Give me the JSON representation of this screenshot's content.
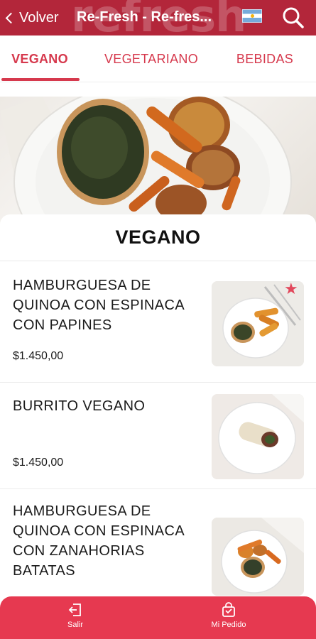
{
  "header": {
    "back_label": "Volver",
    "title": "Re-Fresh - Re-fres...",
    "watermark": "refresh"
  },
  "tabs": [
    {
      "label": "VEGANO",
      "active": true
    },
    {
      "label": "VEGETARIANO",
      "active": false
    },
    {
      "label": "BEBIDAS",
      "active": false
    }
  ],
  "category": {
    "title": "VEGANO"
  },
  "items": [
    {
      "name": "HAMBURGUESA DE QUINOA CON ESPINACA CON PAPINES",
      "price": "$1.450,00",
      "favorite": true
    },
    {
      "name": "BURRITO VEGANO",
      "price": "$1.450,00",
      "favorite": false
    },
    {
      "name": "HAMBURGUESA DE QUINOA CON ESPINACA CON ZANAHORIAS BATATAS",
      "price": "",
      "favorite": false
    }
  ],
  "bottom_nav": {
    "exit_label": "Salir",
    "order_label": "Mi Pedido"
  },
  "colors": {
    "header_bg": "#b3263a",
    "accent": "#d6394d",
    "bottom_bar": "#e63950"
  },
  "icons": {
    "back": "chevron-left-icon",
    "flag": "argentina-flag-icon",
    "search": "search-icon",
    "favorite": "star-icon",
    "exit": "exit-icon",
    "order": "shopping-bag-icon"
  }
}
